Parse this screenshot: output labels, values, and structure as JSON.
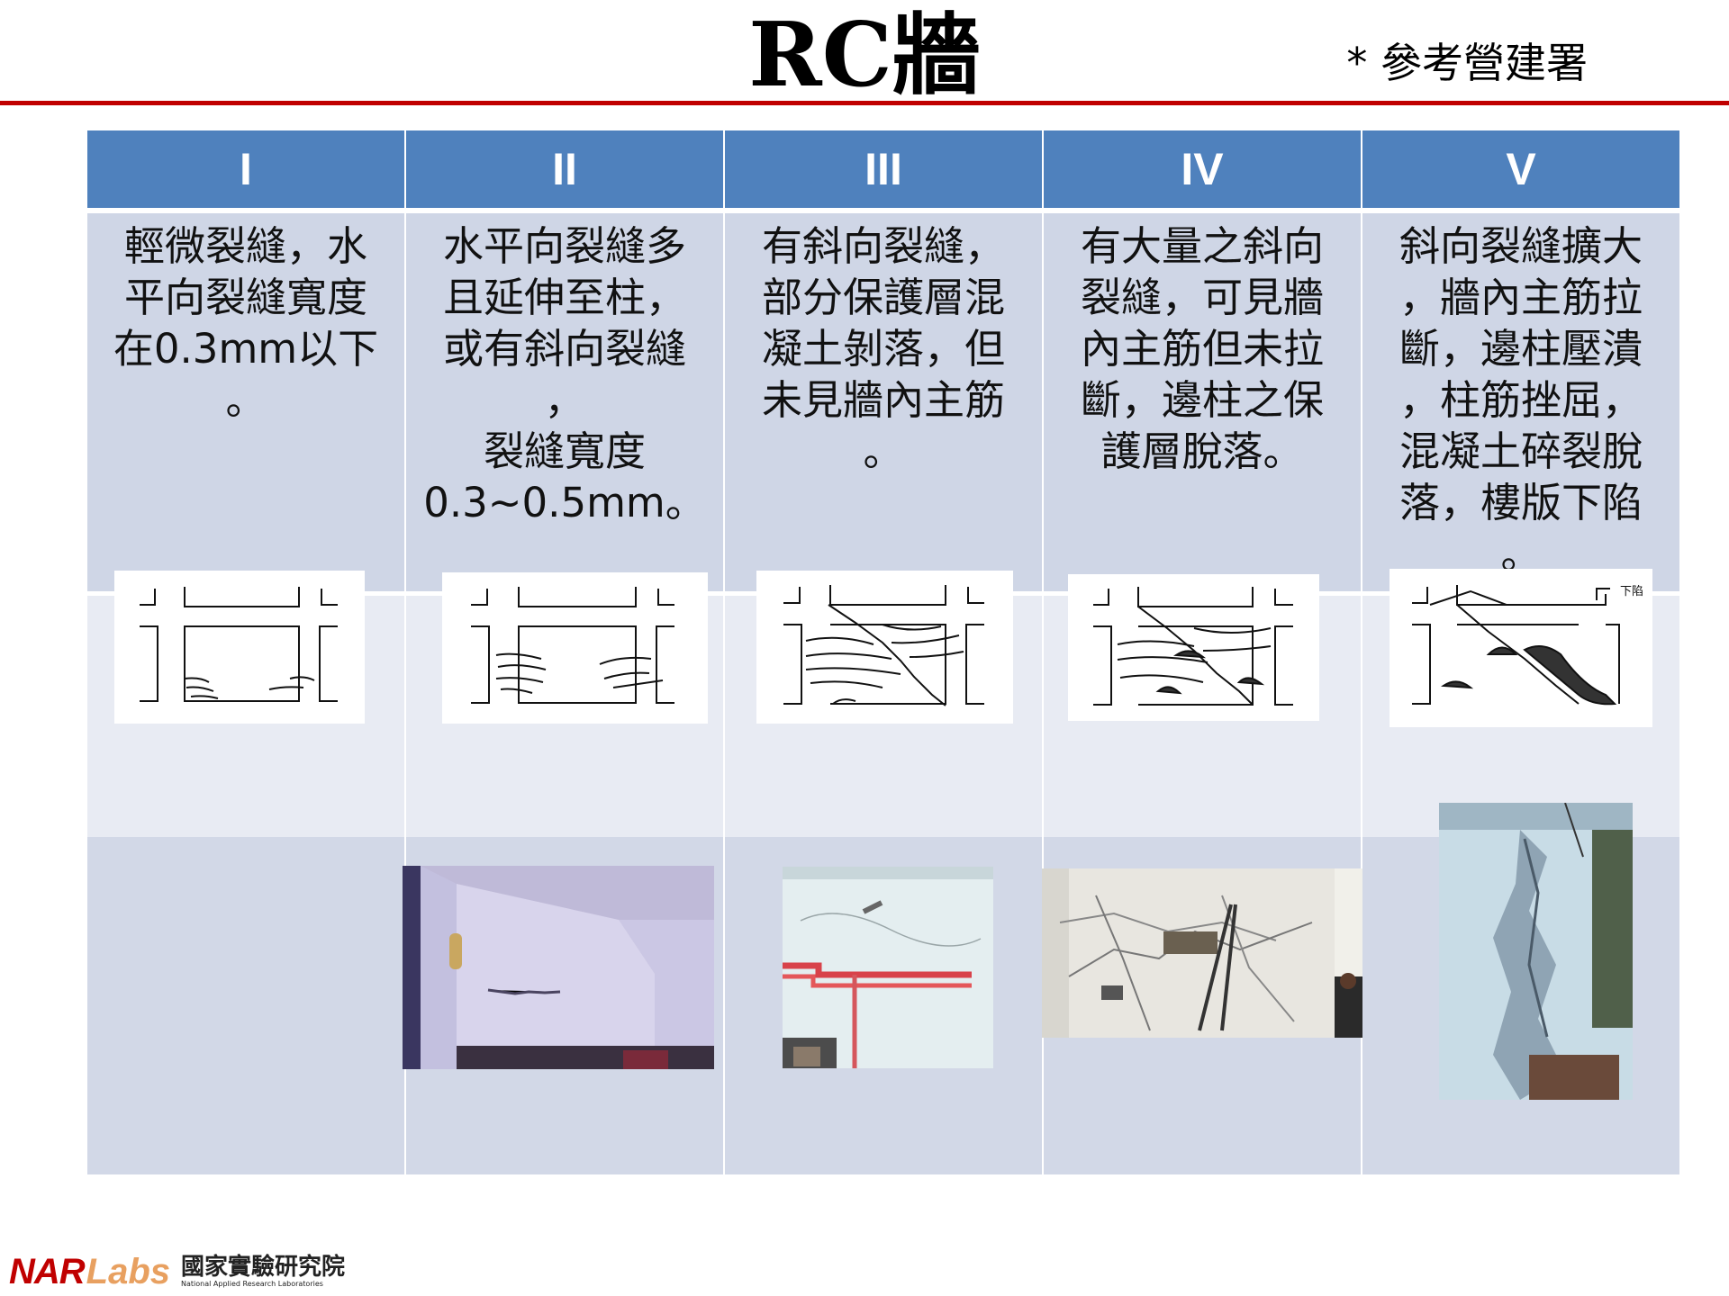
{
  "title": "RC牆",
  "reference": "* 參考營建署",
  "columns": [
    {
      "header": "I",
      "description": "輕微裂縫，水\n平向裂縫寬度\n在0.3mm以下\n。"
    },
    {
      "header": "II",
      "description": "水平向裂縫多\n且延伸至柱，\n或有斜向裂縫\n，\n裂縫寬度\n0.3~0.5mm。"
    },
    {
      "header": "III",
      "description": "有斜向裂縫，\n部分保護層混\n凝土剝落，但\n未見牆內主筋\n。"
    },
    {
      "header": "IV",
      "description": "有大量之斜向\n裂縫，可見牆\n內主筋但未拉\n斷，邊柱之保\n護層脫落。"
    },
    {
      "header": "V",
      "description": "斜向裂縫擴大\n，牆內主筋拉\n斷，邊柱壓潰\n，柱筋挫屈，\n混凝土碎裂脫\n落，樓版下陷\n。"
    }
  ],
  "sketch_v_label": "下陷",
  "logo": {
    "brand_a": "NAR",
    "brand_b": "Labs",
    "name_cn": "國家實驗研究院",
    "name_en": "National Applied Research Laboratories"
  },
  "colors": {
    "header_bg": "#4f81bd",
    "accent_line": "#c00000",
    "row1_bg": "#cfd6e6",
    "row2_bg": "#e8ebf3"
  }
}
